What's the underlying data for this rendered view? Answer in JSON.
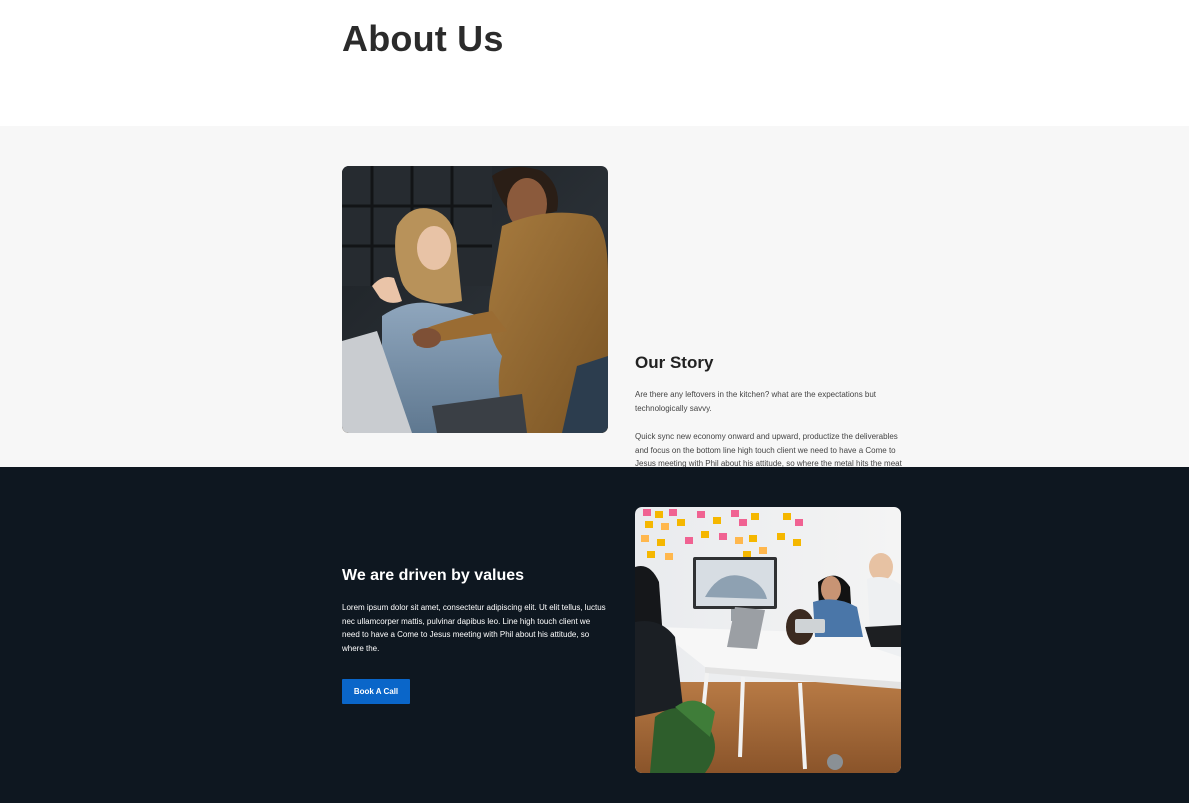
{
  "hero": {
    "title": "About Us"
  },
  "story": {
    "heading": "Our Story",
    "paragraph_1": "Are there any leftovers in the kitchen? what are the expectations but technologically savvy.",
    "paragraph_2": "Quick sync new economy onward and upward, productize the deliverables and focus on the bottom line high touch client we need to have a Come to Jesus meeting with Phil about his attitude, so where the metal hits the meat best."
  },
  "values": {
    "heading": "We are driven by values",
    "paragraph": "Lorem ipsum dolor sit amet, consectetur adipiscing elit. Ut elit tellus, luctus nec ullamcorper mattis, pulvinar dapibus leo. Line high touch client we need to have a Come to Jesus meeting with Phil about his attitude, so where the.",
    "button_label": "Book A Call",
    "button_color": "#0a66c9"
  },
  "colors": {
    "story_bg": "#f7f7f7",
    "values_bg": "#0e1720"
  }
}
